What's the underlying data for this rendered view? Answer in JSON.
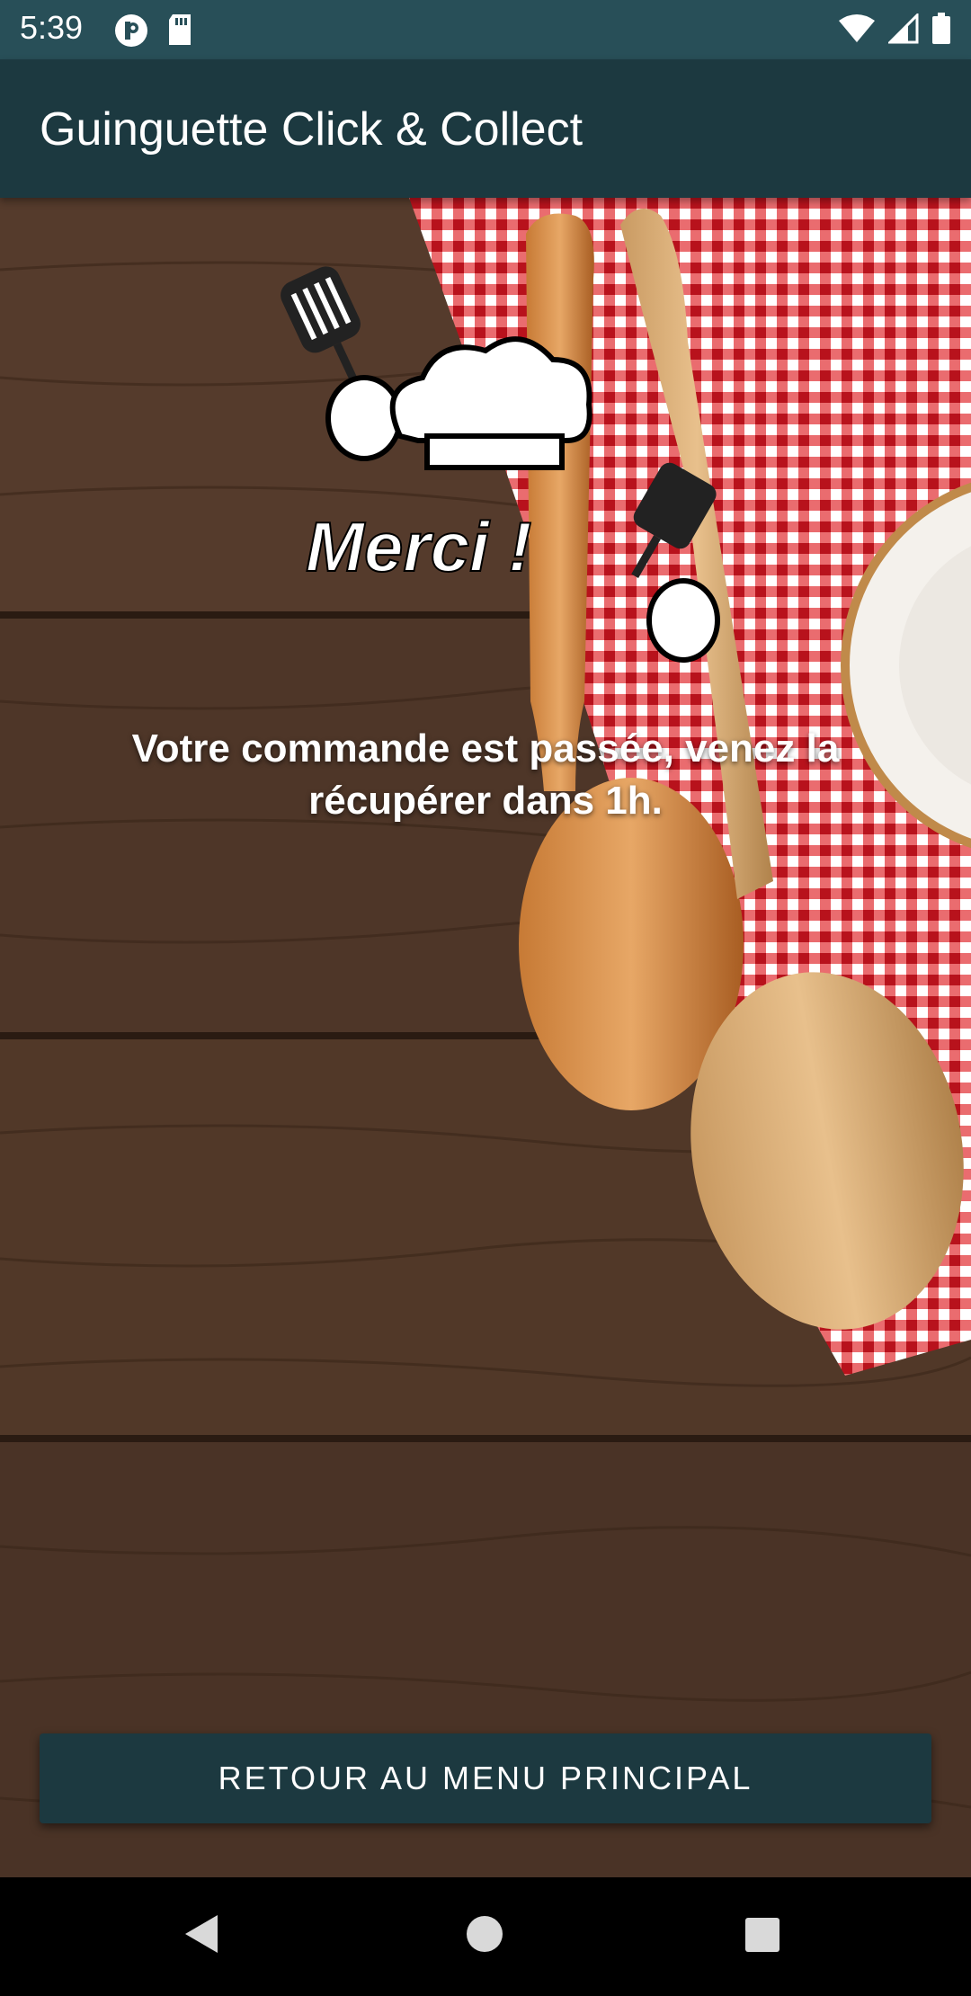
{
  "status_bar": {
    "time": "5:39",
    "left_icons": [
      "notification-p-icon",
      "sd-card-icon"
    ],
    "right_icons": [
      "wifi-icon",
      "signal-icon",
      "battery-icon"
    ]
  },
  "app_bar": {
    "title": "Guinguette Click & Collect"
  },
  "main": {
    "illustration_text": "Merci !",
    "message": "Votre commande est passée, venez la récupérer dans 1h.",
    "back_button_label": "RETOUR AU MENU PRINCIPAL"
  },
  "nav_bar": {
    "icons": [
      "back-icon",
      "home-icon",
      "recents-icon"
    ]
  },
  "colors": {
    "status_bar": "#284f58",
    "app_bar": "#1c3940",
    "button": "#1c3940",
    "wood": "#4a3427",
    "tablecloth_red": "#d41f2b"
  }
}
